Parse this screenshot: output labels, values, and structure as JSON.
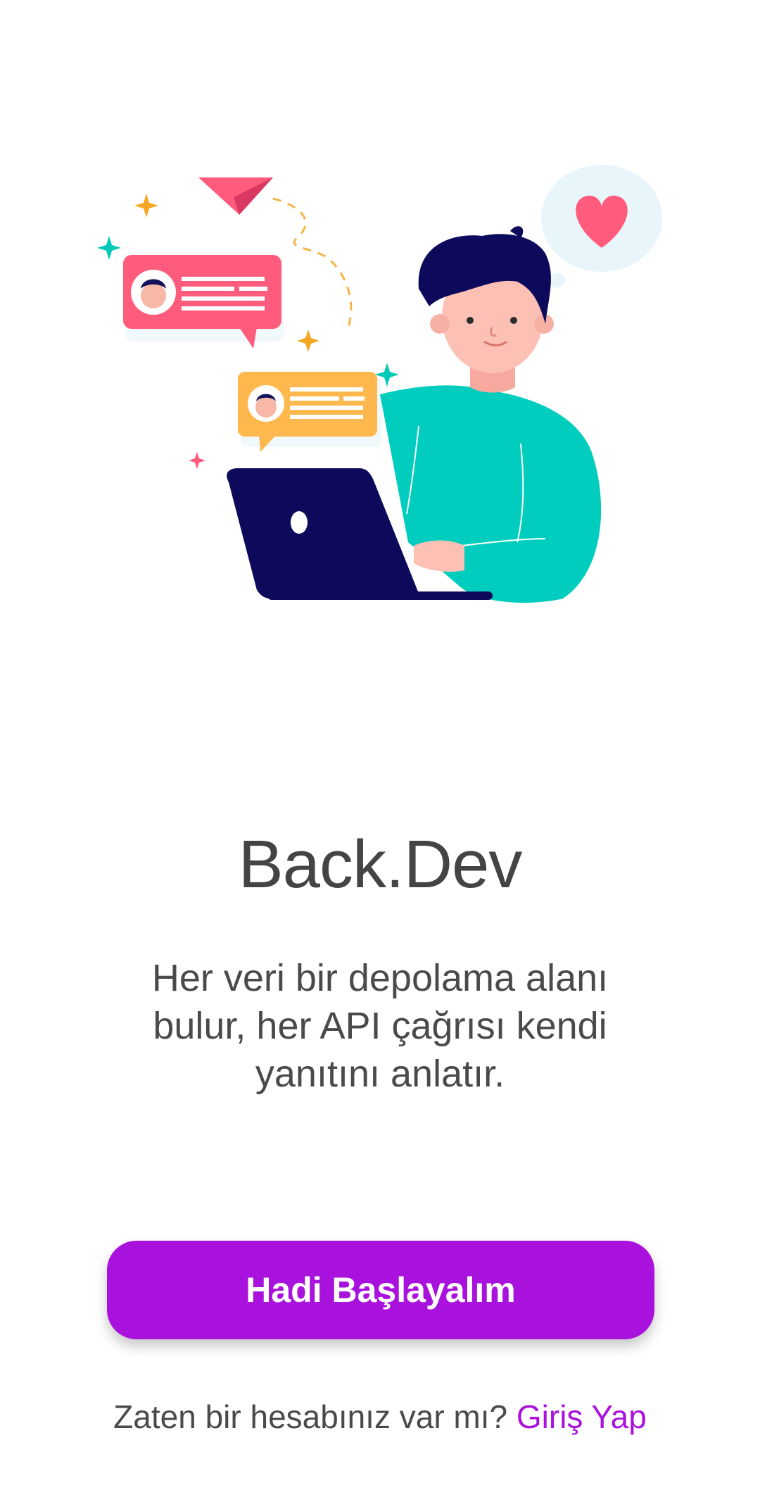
{
  "app": {
    "title": "Back.Dev",
    "tagline": "Her veri bir depolama alanı bulur, her API çağrısı kendi yanıtını anlatır."
  },
  "actions": {
    "primary_label": "Hadi Başlayalım",
    "signin_prompt": "Zaten bir hesabınız var mı?",
    "signin_link": "Giriş Yap"
  },
  "colors": {
    "accent": "#a912dc",
    "title_text": "#444444",
    "body_text": "#4a4a4a",
    "background": "#ffffff"
  },
  "illustration": {
    "icons": [
      "paper-plane-icon",
      "heart-icon",
      "chat-bubble-icon",
      "laptop-icon",
      "sparkle-icon"
    ]
  }
}
